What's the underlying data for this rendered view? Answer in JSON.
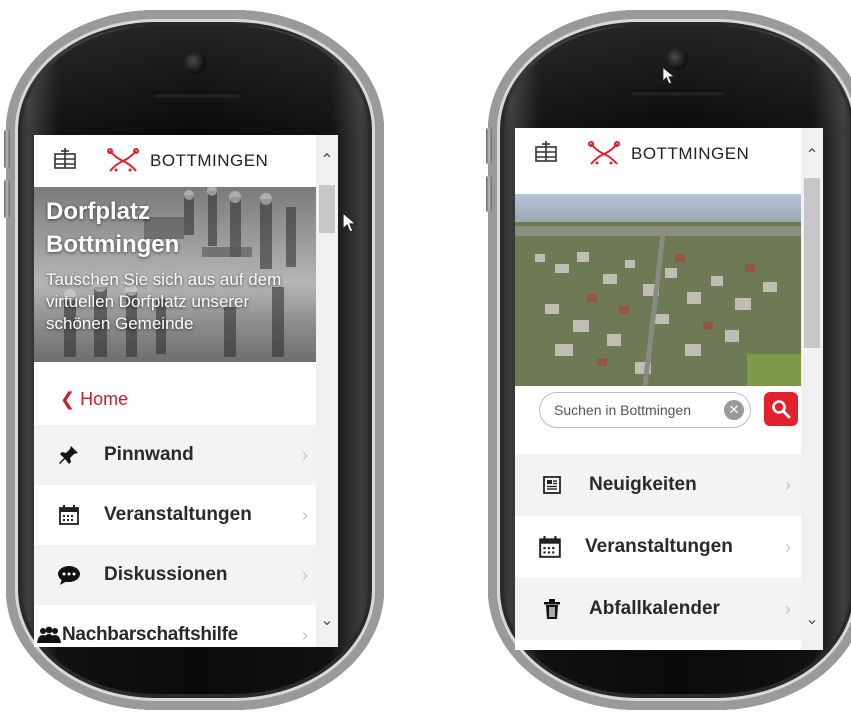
{
  "brand": {
    "name": "BOTTMINGEN",
    "accent_color": "#e3202e"
  },
  "left_screen": {
    "hero": {
      "title_line1": "Dorfplatz",
      "title_line2": "Bottmingen",
      "subtitle": "Tauschen Sie sich aus auf dem virtuellen Dorfplatz unserer schönen Gemeinde"
    },
    "back_link": {
      "icon": "chevron-left-icon",
      "label": "Home"
    },
    "menu": [
      {
        "label": "Pinnwand",
        "icon": "pushpin-icon"
      },
      {
        "label": "Veranstaltungen",
        "icon": "calendar-icon"
      },
      {
        "label": "Diskussionen",
        "icon": "speech-bubble-icon"
      },
      {
        "label": "Nachbarschaftshilfe",
        "icon": "people-icon"
      }
    ]
  },
  "right_screen": {
    "search": {
      "placeholder": "Suchen in Bottmingen"
    },
    "menu": [
      {
        "label": "Neuigkeiten",
        "icon": "newspaper-icon"
      },
      {
        "label": "Veranstaltungen",
        "icon": "calendar-icon"
      },
      {
        "label": "Abfallkalender",
        "icon": "trash-icon"
      }
    ]
  }
}
